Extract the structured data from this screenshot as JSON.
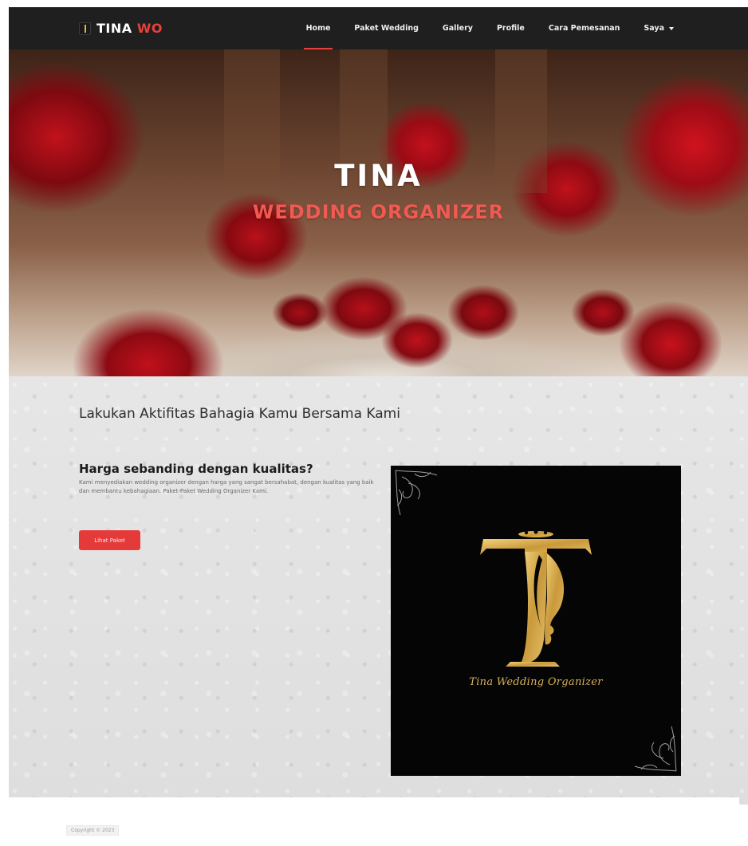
{
  "brand": {
    "name_main": "TINA",
    "name_accent": "WO",
    "accent_color": "#e8403a"
  },
  "nav": {
    "items": [
      {
        "label": "Home",
        "active": true
      },
      {
        "label": "Paket Wedding",
        "active": false
      },
      {
        "label": "Gallery",
        "active": false
      },
      {
        "label": "Profile",
        "active": false
      },
      {
        "label": "Cara Pemesanan",
        "active": false
      },
      {
        "label": "Saya",
        "active": false,
        "dropdown": true
      }
    ]
  },
  "hero": {
    "title": "TINA",
    "subtitle": "WEDDING ORGANIZER"
  },
  "main": {
    "headline": "Lakukan Aktifitas Bahagia Kamu Bersama Kami",
    "subheading": "Harga sebanding dengan kualitas?",
    "body": "Kami menyediakan wedding organizer dengan harga yang sangat bersahabat, dengan kualitas yang baik dan membantu kebahagiaan. Paket-Paket Wedding Organizer Kami.",
    "cta_label": "Lihat Paket"
  },
  "logo_image": {
    "tagline": "Tina Wedding Organizer",
    "gold_color": "#d8b25a"
  },
  "footer": {
    "copyright": "Copyright © 2023"
  }
}
